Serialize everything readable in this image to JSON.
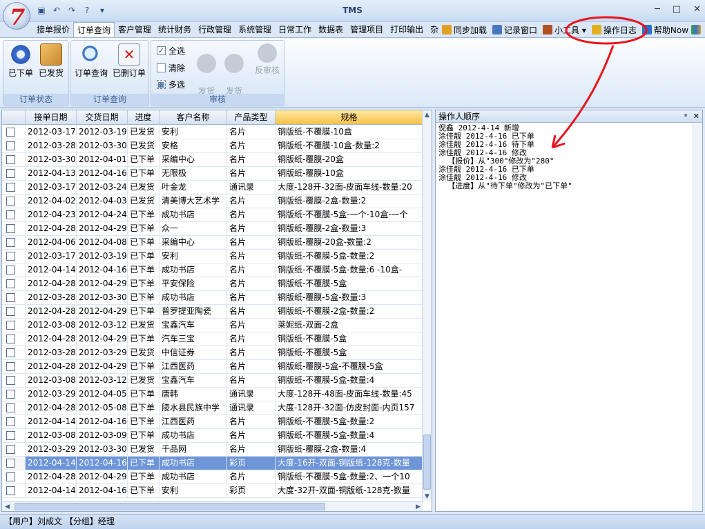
{
  "app": {
    "title": "TMS",
    "logo_text": "7"
  },
  "window_controls": {
    "minimize": "─",
    "maximize": "□",
    "close": "✕"
  },
  "quick_access": [
    "save-icon",
    "undo-icon",
    "redo-icon",
    "help-icon",
    "customize-icon"
  ],
  "menu": [
    "接单报价",
    "订单查询",
    "客户管理",
    "统计财务",
    "行政管理",
    "系统管理",
    "日常工作",
    "数据表",
    "管理项目",
    "打印输出",
    "杂"
  ],
  "menu_active": 1,
  "menu_right": [
    {
      "label": "同步加载",
      "icon": "sync-icon"
    },
    {
      "label": "记录窗口",
      "icon": "window-icon"
    },
    {
      "label": "小工具 ▾",
      "icon": "tools-icon"
    },
    {
      "label": "操作日志",
      "icon": "pencil-icon"
    },
    {
      "label": "帮助Now",
      "icon": "help-icon"
    }
  ],
  "ribbon": {
    "group_order_status": {
      "label": "订单状态",
      "btn1": "已下单",
      "btn2": "已发货"
    },
    "group_order_query": {
      "label": "订单查询",
      "btn1": "订单查询",
      "btn2": "已删订单"
    },
    "group_audit": {
      "label": "审核",
      "select_all": "全选",
      "clear": "清除",
      "multi": "多选",
      "ship_settle": "发货\n结账",
      "ship_unsettle": "发货\n不结账",
      "unaudit": "反审核"
    }
  },
  "grid": {
    "columns": [
      "",
      "接单日期",
      "交货日期",
      "进度",
      "客户名称",
      "产品类型",
      "规格"
    ],
    "sorted_column": 6,
    "rows": [
      [
        "2012-03-17",
        "2012-03-19",
        "已发货",
        "安利",
        "名片",
        "铜版纸-不覆膜-10盒"
      ],
      [
        "2012-03-28",
        "2012-03-30",
        "已发货",
        "安格",
        "名片",
        "铜版纸-不覆膜-10盒-数量:2"
      ],
      [
        "2012-03-30",
        "2012-04-01",
        "已下单",
        "采编中心",
        "名片",
        "铜版纸-覆膜-20盒"
      ],
      [
        "2012-04-13",
        "2012-04-16",
        "已下单",
        "无限极",
        "名片",
        "铜版纸-覆膜-10盒"
      ],
      [
        "2012-03-17",
        "2012-03-24",
        "已发货",
        "叶金龙",
        "通讯录",
        "大度-128开-32面-皮面车线-数量:20"
      ],
      [
        "2012-04-02",
        "2012-04-03",
        "已发货",
        "清美博大艺术学",
        "名片",
        "铜版纸-覆膜-2盒-数量:2"
      ],
      [
        "2012-04-23",
        "2012-04-24",
        "已下单",
        "成功书店",
        "名片",
        "铜版纸-不覆膜-5盒-一个-10盒-一个"
      ],
      [
        "2012-04-28",
        "2012-04-29",
        "已下单",
        "众一",
        "名片",
        "铜版纸-覆膜-2盒-数量:3"
      ],
      [
        "2012-04-06",
        "2012-04-08",
        "已下单",
        "采编中心",
        "名片",
        "铜版纸-覆膜-20盒-数量:2"
      ],
      [
        "2012-03-17",
        "2012-03-19",
        "已下单",
        "安利",
        "名片",
        "铜版纸-不覆膜-5盒-数量:2"
      ],
      [
        "2012-04-14",
        "2012-04-16",
        "已下单",
        "成功书店",
        "名片",
        "铜版纸-不覆膜-5盒-数量:6 -10盒-"
      ],
      [
        "2012-04-28",
        "2012-04-29",
        "已下单",
        "平安保险",
        "名片",
        "铜版纸-不覆膜-5盒"
      ],
      [
        "2012-03-28",
        "2012-03-30",
        "已下单",
        "成功书店",
        "名片",
        "铜版纸-覆膜-5盒-数量:3"
      ],
      [
        "2012-04-28",
        "2012-04-29",
        "已下单",
        "普罗提亚陶瓷",
        "名片",
        "铜版纸-不覆膜-2盒-数量:2"
      ],
      [
        "2012-03-08",
        "2012-03-12",
        "已发货",
        "宝鑫汽车",
        "名片",
        "莱妮纸-双面-2盒"
      ],
      [
        "2012-04-28",
        "2012-04-29",
        "已下单",
        "汽车三宝",
        "名片",
        "铜版纸-不覆膜-5盒"
      ],
      [
        "2012-03-28",
        "2012-03-29",
        "已发货",
        "中信证券",
        "名片",
        "铜版纸-不覆膜-5盒"
      ],
      [
        "2012-04-28",
        "2012-04-29",
        "已下单",
        "江西医药",
        "名片",
        "铜版纸-覆膜-5盒-不覆膜-5盒"
      ],
      [
        "2012-03-08",
        "2012-03-12",
        "已发货",
        "宝鑫汽车",
        "名片",
        "铜版纸-不覆膜-5盒-数量:4"
      ],
      [
        "2012-03-29",
        "2012-04-05",
        "已下单",
        "唐韩",
        "通讯录",
        "大度-128开-48面-皮面车线-数量:45"
      ],
      [
        "2012-04-28",
        "2012-05-08",
        "已下单",
        "陵水县民族中学",
        "通讯录",
        "大度-128开-32面-仿皮封面-内页157"
      ],
      [
        "2012-04-14",
        "2012-04-16",
        "已下单",
        "江西医药",
        "名片",
        "铜版纸-不覆膜-5盒-数量:2"
      ],
      [
        "2012-03-08",
        "2012-03-09",
        "已下单",
        "成功书店",
        "名片",
        "铜版纸-不覆膜-5盒-数量:4"
      ],
      [
        "2012-03-29",
        "2012-03-30",
        "已发货",
        "千品网",
        "名片",
        "铜版纸-覆膜-2盒-数量:4"
      ],
      [
        "2012-04-14",
        "2012-04-16",
        "已下单",
        "成功书店",
        "彩页",
        "大度-16开-双面-铜版纸-128克-数量"
      ],
      [
        "2012-04-28",
        "2012-04-29",
        "已下单",
        "成功书店",
        "名片",
        "铜版纸-不覆膜-5盒-数量:2、一个10"
      ],
      [
        "2012-04-14",
        "2012-04-16",
        "已下单",
        "安利",
        "彩页",
        "大度-32开-双面-铜版纸-128克-数量"
      ]
    ],
    "selected_row": 24
  },
  "log_panel": {
    "title": "操作人顺序",
    "pin": "ᵖ",
    "close": "✕",
    "lines": [
      "倪鑫 2012-4-14 新增",
      "涂佳靓 2012-4-16 已下单",
      "涂佳靓 2012-4-16 待下单",
      "涂佳靓 2012-4-16 修改",
      "  【报价】从\"300\"修改为\"280\"",
      "涂佳靓 2012-4-16 已下单",
      "涂佳靓 2012-4-16 修改",
      "  【进度】从\"待下单\"修改为\"已下单\""
    ]
  },
  "status": {
    "text": "【用户】刘成文  【分组】经理"
  },
  "colors": {
    "accent": "#6d95d8",
    "annotation": "#e8141e",
    "logo": "#d42020"
  }
}
